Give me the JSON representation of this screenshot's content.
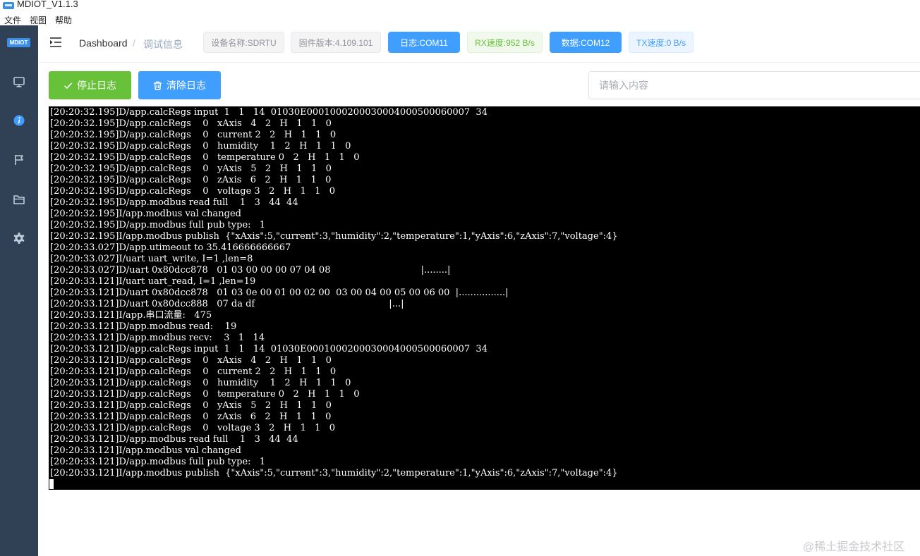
{
  "window": {
    "title": "MDIOT_V1.1.3"
  },
  "menu": [
    {
      "label": "文件"
    },
    {
      "label": "视图"
    },
    {
      "label": "帮助"
    }
  ],
  "sidebar": {
    "brand": "MDIOT"
  },
  "breadcrumb": {
    "home": "Dashboard",
    "separator": "/",
    "current": "调试信息"
  },
  "status_tags": [
    {
      "label": "设备名称:SDRTU",
      "style": "gray"
    },
    {
      "label": "固件版本:4.109.101",
      "style": "gray"
    },
    {
      "label": "日志:COM11",
      "style": "blue"
    },
    {
      "label": "RX速度:952 B/s",
      "style": "green"
    },
    {
      "label": "数据:COM12",
      "style": "blue"
    },
    {
      "label": "TX速度:0 B/s",
      "style": "lightblue"
    }
  ],
  "toolbar": {
    "stop_label": "停止日志",
    "clear_label": "清除日志"
  },
  "search": {
    "placeholder": "请输入内容",
    "value": ""
  },
  "colors": {
    "sidebar": "#304156",
    "primary": "#409eff",
    "success": "#67c23a",
    "terminal_bg": "#000000",
    "terminal_fg": "#ffffff"
  },
  "log_lines": [
    "[20:20:32.195]D/app.calcRegs input  1   1   14  01030E0001000200030004000500060007  34",
    "[20:20:32.195]D/app.calcRegs    0   xAxis   4   2   H   1   1   0",
    "[20:20:32.195]D/app.calcRegs    0   current 2   2   H   1   1   0",
    "[20:20:32.195]D/app.calcRegs    0   humidity    1   2   H   1   1   0",
    "[20:20:32.195]D/app.calcRegs    0   temperature 0   2   H   1   1   0",
    "[20:20:32.195]D/app.calcRegs    0   yAxis   5   2   H   1   1   0",
    "[20:20:32.195]D/app.calcRegs    0   zAxis   6   2   H   1   1   0",
    "[20:20:32.195]D/app.calcRegs    0   voltage 3   2   H   1   1   0",
    "[20:20:32.195]D/app.modbus read full    1   3   44  44",
    "[20:20:32.195]I/app.modbus val changed",
    "[20:20:32.195]D/app.modbus full pub type:   1",
    "[20:20:32.195]I/app.modbus publish  {\"xAxis\":5,\"current\":3,\"humidity\":2,\"temperature\":1,\"yAxis\":6,\"zAxis\":7,\"voltage\":4}",
    "[20:20:33.027]D/app.utimeout to 35.416666666667",
    "[20:20:33.027]I/uart uart_write, I=1 ,len=8",
    "[20:20:33.027]D/uart 0x80dcc878   01 03 00 00 00 07 04 08                               |........|",
    "[20:20:33.121]I/uart uart_read, I=1 ,len=19",
    "[20:20:33.121]D/uart 0x80dcc878   01 03 0e 00 01 00 02 00  03 00 04 00 05 00 06 00  |................|",
    "[20:20:33.121]D/uart 0x80dcc888   07 da df                                              |...|",
    "[20:20:33.121]I/app.串口流量:   475",
    "[20:20:33.121]D/app.modbus read:    19",
    "[20:20:33.121]D/app.modbus recv:    3   1   14",
    "[20:20:33.121]D/app.calcRegs input  1   1   14  01030E0001000200030004000500060007  34",
    "[20:20:33.121]D/app.calcRegs    0   xAxis   4   2   H   1   1   0",
    "[20:20:33.121]D/app.calcRegs    0   current 2   2   H   1   1   0",
    "[20:20:33.121]D/app.calcRegs    0   humidity    1   2   H   1   1   0",
    "[20:20:33.121]D/app.calcRegs    0   temperature 0   2   H   1   1   0",
    "[20:20:33.121]D/app.calcRegs    0   yAxis   5   2   H   1   1   0",
    "[20:20:33.121]D/app.calcRegs    0   zAxis   6   2   H   1   1   0",
    "[20:20:33.121]D/app.calcRegs    0   voltage 3   2   H   1   1   0",
    "[20:20:33.121]D/app.modbus read full    1   3   44  44",
    "[20:20:33.121]I/app.modbus val changed",
    "[20:20:33.121]D/app.modbus full pub type:   1",
    "[20:20:33.121]I/app.modbus publish  {\"xAxis\":5,\"current\":3,\"humidity\":2,\"temperature\":1,\"yAxis\":6,\"zAxis\":7,\"voltage\":4}"
  ],
  "watermark": "@稀土掘金技术社区"
}
